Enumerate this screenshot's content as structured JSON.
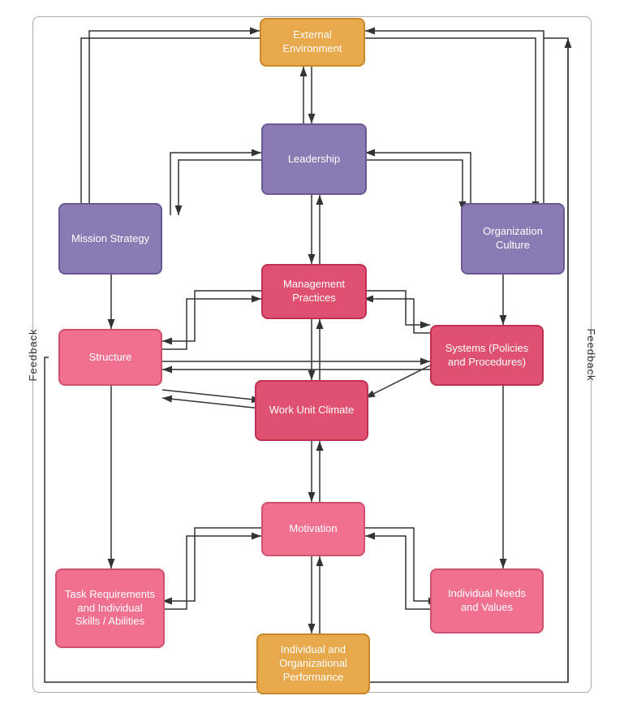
{
  "nodes": {
    "external_environment": {
      "label": "External\nEnvironment"
    },
    "leadership": {
      "label": "Leadership"
    },
    "mission_strategy": {
      "label": "Mission Strategy"
    },
    "organization_culture": {
      "label": "Organization\nCulture"
    },
    "management_practices": {
      "label": "Management\nPractices"
    },
    "structure": {
      "label": "Structure"
    },
    "systems": {
      "label": "Systems (Policies\nand Procedures)"
    },
    "work_unit_climate": {
      "label": "Work Unit Climate"
    },
    "motivation": {
      "label": "Motivation"
    },
    "task_requirements": {
      "label": "Task Requirements\nand Individual\nSkills / Abilities"
    },
    "individual_needs": {
      "label": "Individual Needs\nand Values"
    },
    "individual_org_performance": {
      "label": "Individual and\nOrganizational\nPerformance"
    }
  },
  "feedback_label": "Feedback"
}
